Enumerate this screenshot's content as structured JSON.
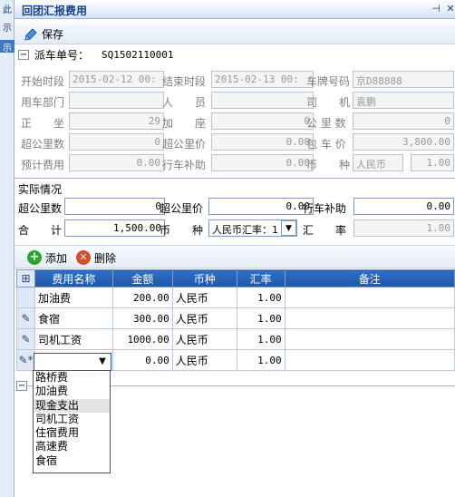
{
  "left_strip": {
    "labels": [
      "此",
      "示",
      "示"
    ]
  },
  "window": {
    "title": "回团汇报费用",
    "pin_icon": "pin-icon",
    "close_icon": "close-icon"
  },
  "toolbar": {
    "save_label": "保存"
  },
  "dispatch": {
    "label": "派车单号：",
    "number": "SQ1502110001",
    "fields": {
      "start_label": "开始时段",
      "start_value": "2015-02-12 00:",
      "end_label": "结束时段",
      "end_value": "2015-02-13 00:",
      "plate_label": "车牌号码",
      "plate_value": "京D88888",
      "dept_label": "用车部门",
      "dept_value": "",
      "person_label": "人　　员",
      "person_value": "",
      "driver_label": "司　　机",
      "driver_value": "袁鹏",
      "seats_label": "正　　坐",
      "seats_value": "29",
      "extra_seats_label": "加　　座",
      "extra_seats_value": "0",
      "km_label": "公 里 数",
      "km_value": "0",
      "over_km_label": "超公里数",
      "over_km_value": "0",
      "over_km_price_label": "超公里价",
      "over_km_price_value": "0.00",
      "charter_price_label": "包 车 价",
      "charter_price_value": "3,800.00",
      "est_cost_label": "预计费用",
      "est_cost_value": "0.00",
      "subsidy_label": "行车补助",
      "subsidy_value": "0.00",
      "currency_label": "币　　种",
      "currency_value": "人民币",
      "rate_value": "1.00"
    }
  },
  "actual": {
    "section_label": "实际情况",
    "over_km_label": "超公里数",
    "over_km_value": "0",
    "over_km_price_label": "超公里价",
    "over_km_price_value": "0.00",
    "subsidy_label": "行车补助",
    "subsidy_value": "0.00",
    "total_label": "合　　计",
    "total_value": "1,500.00",
    "currency_label": "币　　种",
    "currency_value": "人民币汇率：1",
    "rate_label": "汇　　率",
    "rate_value": "1.00"
  },
  "grid_toolbar": {
    "add_label": "添加",
    "delete_label": "删除"
  },
  "grid": {
    "headers": [
      "费用名称",
      "金额",
      "币种",
      "汇率",
      "备注"
    ],
    "rows": [
      {
        "name": "加油费",
        "amount": "200.00",
        "currency": "人民币",
        "rate": "1.00",
        "note": ""
      },
      {
        "name": "食宿",
        "amount": "300.00",
        "currency": "人民币",
        "rate": "1.00",
        "note": ""
      },
      {
        "name": "司机工资",
        "amount": "1000.00",
        "currency": "人民币",
        "rate": "1.00",
        "note": ""
      },
      {
        "name": "",
        "amount": "0.00",
        "currency": "人民币",
        "rate": "1.00",
        "note": ""
      }
    ]
  },
  "dropdown": {
    "options": [
      "路桥费",
      "加油费",
      "现金支出",
      "司机工资",
      "住宿费用",
      "高速费",
      "食宿"
    ],
    "highlighted_index": 2
  },
  "colors": {
    "header_blue": "#1d57ab",
    "title_text": "#15428b"
  }
}
